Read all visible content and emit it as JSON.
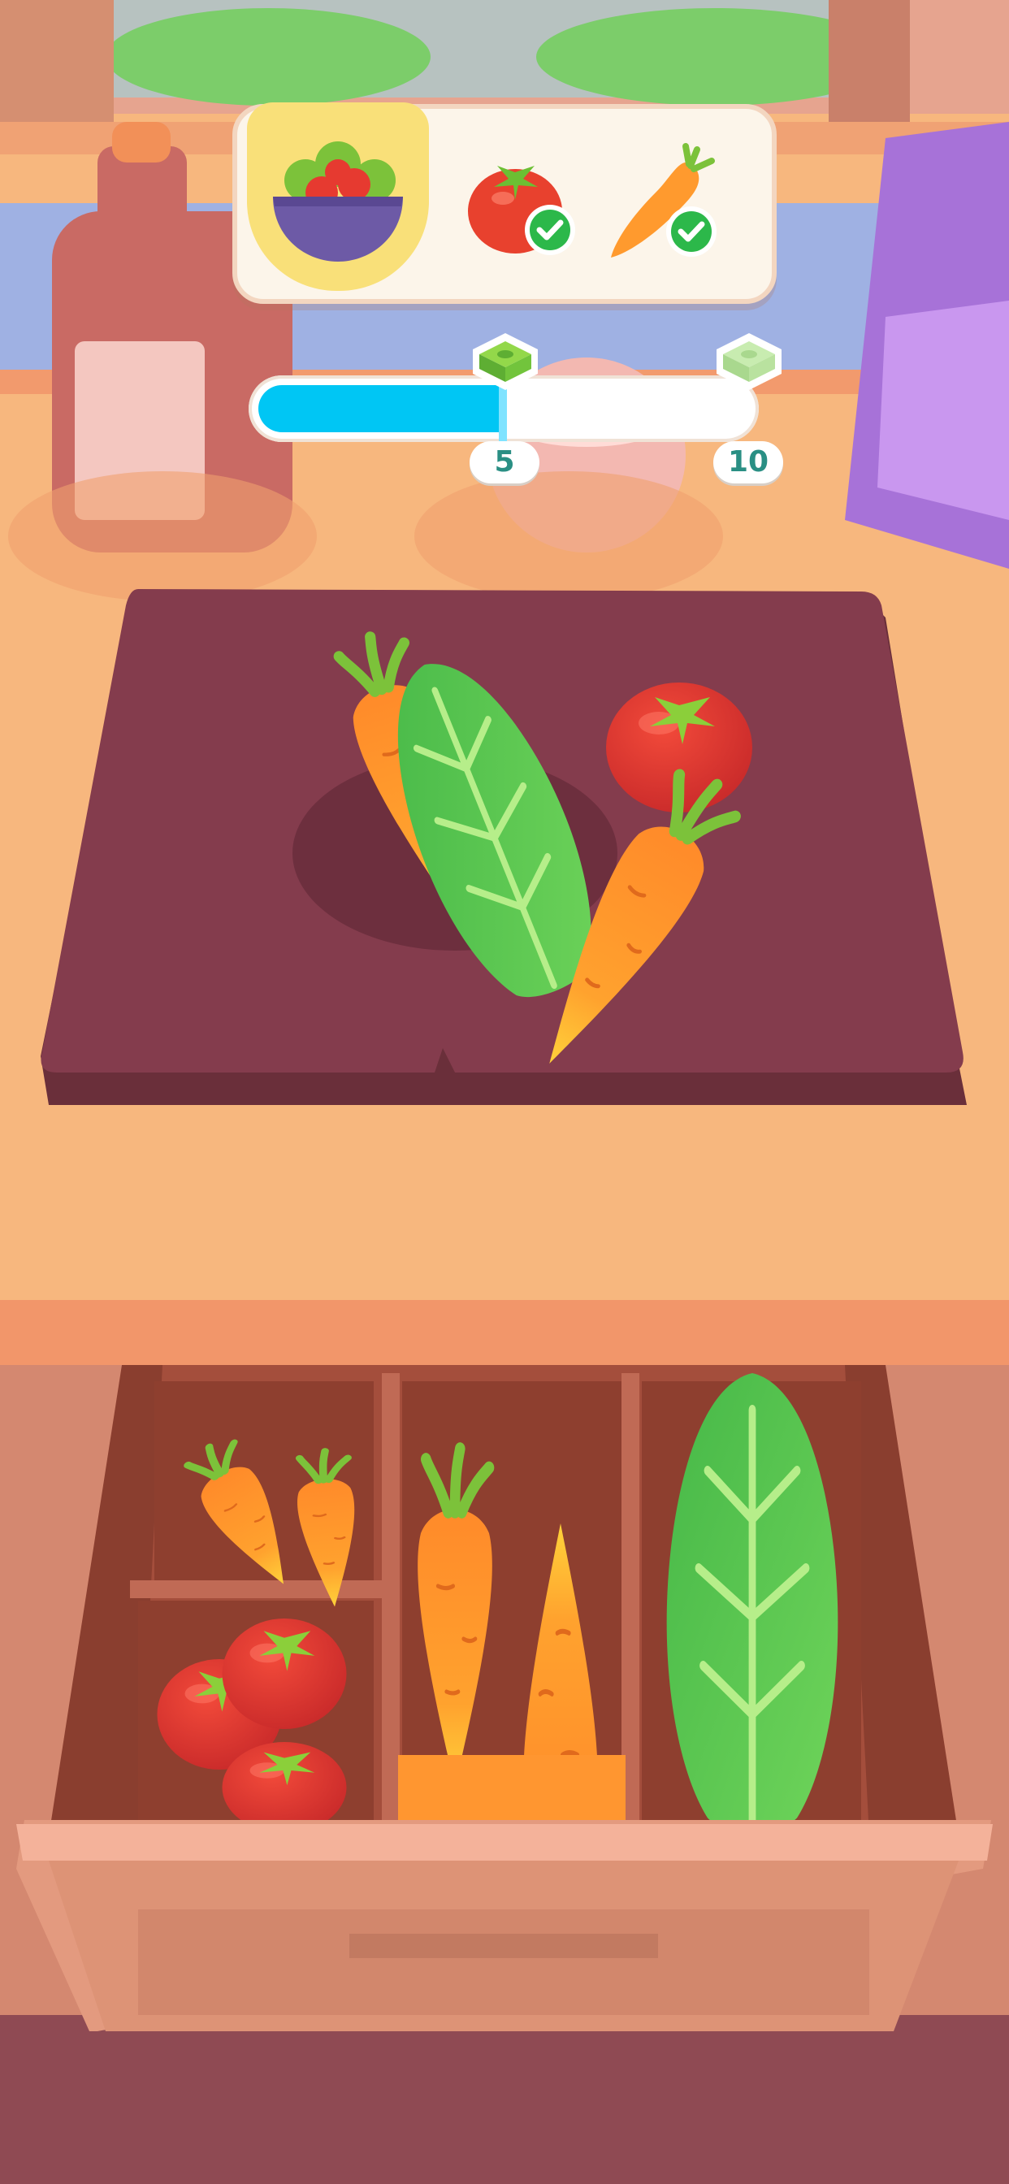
{
  "recipe": {
    "dish_icon": "salad-bowl-icon",
    "ingredients": [
      {
        "icon": "tomato-icon",
        "status_icon": "check-icon",
        "done": true
      },
      {
        "icon": "carrot-icon",
        "status_icon": "check-icon",
        "done": true
      }
    ]
  },
  "progress": {
    "value": 5,
    "max": 10,
    "fraction": 0.5,
    "markers": [
      {
        "label": "5",
        "icon": "cash-stack-icon"
      },
      {
        "label": "10",
        "icon": "cash-stack-icon"
      }
    ],
    "colors": {
      "fill": "#00c6f4",
      "track": "#ffffff"
    }
  },
  "board_items": [
    "carrot-icon",
    "lettuce-icon",
    "tomato-icon",
    "carrot-icon"
  ],
  "drawer": {
    "compartments": [
      {
        "name": "carrots-small",
        "items": [
          "carrot-icon",
          "carrot-icon"
        ]
      },
      {
        "name": "tomatoes",
        "items": [
          "tomato-icon",
          "tomato-icon",
          "tomato-icon"
        ]
      },
      {
        "name": "carrots-large",
        "items": [
          "carrot-icon",
          "carrot-icon"
        ]
      },
      {
        "name": "lettuce",
        "items": [
          "lettuce-icon"
        ]
      }
    ]
  }
}
